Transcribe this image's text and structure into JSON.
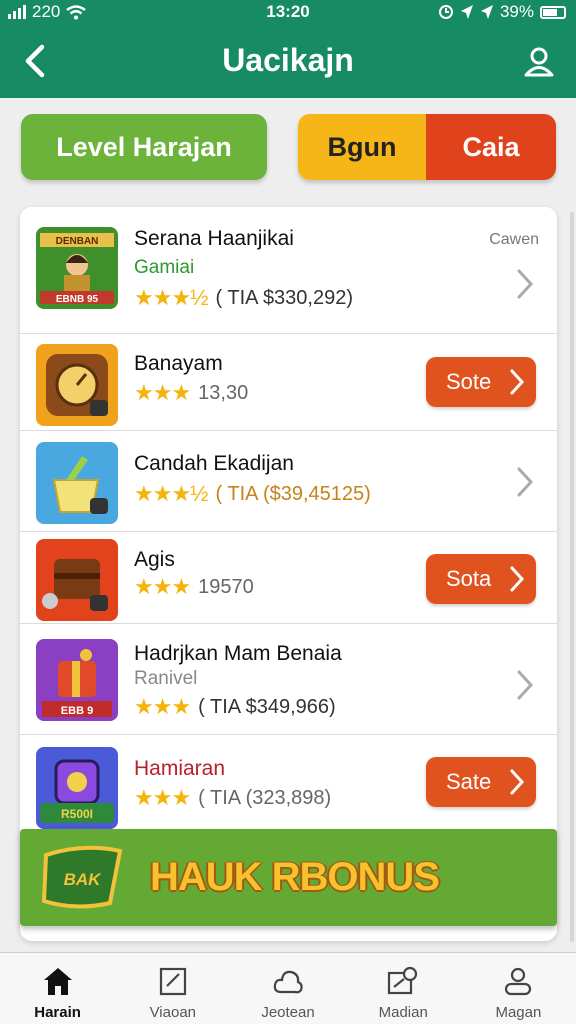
{
  "status_bar": {
    "signal": "220",
    "time": "13:20",
    "battery": "39%"
  },
  "header": {
    "title": "Uacikajn"
  },
  "tabs": {
    "left_label": "Level Harajan",
    "right_a_label": "Bgun",
    "right_b_label": "Caia"
  },
  "list": {
    "items": [
      {
        "title": "Serana Haanjikai",
        "subtitle": "Gamiai",
        "subtitle_color": "#2e9a2e",
        "stars": "★★★½",
        "meta": "( TIA  $330,292)",
        "corner": "Cawen",
        "action": "chevron"
      },
      {
        "title": "Banayam",
        "stars": "★★★",
        "meta": "13,30",
        "action": "sale",
        "action_label": "Sote"
      },
      {
        "title": "Candah Ekadijan",
        "stars": "★★★½",
        "meta": "( TIA  ($39,45125)",
        "meta_color": "#c9811a",
        "action": "chevron"
      },
      {
        "title": "Agis",
        "stars": "★★★",
        "meta": "19570",
        "action": "sale",
        "action_label": "Sota"
      },
      {
        "title": "Hadrjkan Mam Benaia",
        "subtitle": "Ranivel",
        "subtitle_color": "#888888",
        "stars": "★★★",
        "meta": "( TIA  $349,966)",
        "action": "chevron"
      },
      {
        "title": "Hamiaran",
        "title_color": "#b8202a",
        "stars": "★★★",
        "meta": "( TIA  (323,898)",
        "action": "sale",
        "action_label": "Sate"
      }
    ],
    "thumb_labels": {
      "item0_top": "DENBAN",
      "item0_bottom": "EBNB 95",
      "item4_bottom": "EBB 9",
      "item5_bottom": "R500I"
    }
  },
  "bonus": {
    "text": "HAUK RBONUS",
    "badge_text": "BAK"
  },
  "bottom_nav": [
    {
      "label": "Harain",
      "icon": "home-icon",
      "active": true
    },
    {
      "label": "Viaoan",
      "icon": "edit-icon",
      "active": false
    },
    {
      "label": "Jeotean",
      "icon": "cloud-icon",
      "active": false
    },
    {
      "label": "Madian",
      "icon": "search-icon",
      "active": false
    },
    {
      "label": "Magan",
      "icon": "user-icon",
      "active": false
    }
  ],
  "colors": {
    "header": "#178c64",
    "green": "#6bb33a",
    "yellow": "#f6b617",
    "red": "#e0431c",
    "sale": "#e0531f",
    "star": "#f5b40b"
  }
}
